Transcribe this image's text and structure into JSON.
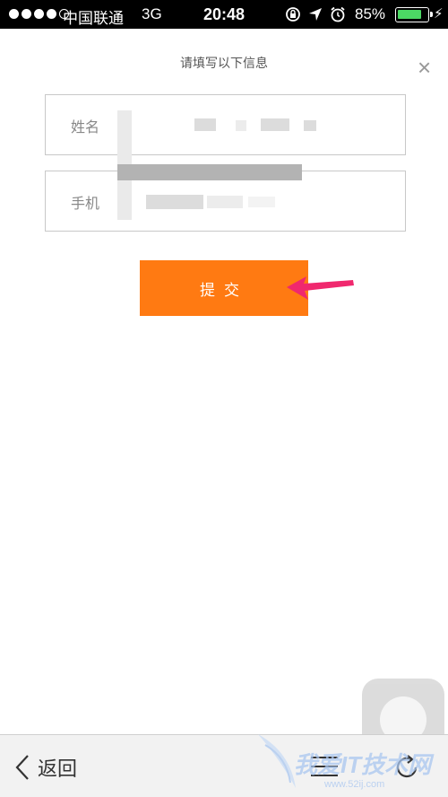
{
  "status_bar": {
    "carrier": "中国联通",
    "network": "3G",
    "time": "20:48",
    "battery": "85%",
    "battery_level": 0.85,
    "battery_color": "#4cd964"
  },
  "form": {
    "title": "请填写以下信息",
    "close_icon": "close-icon",
    "name_label": "姓名",
    "phone_label": "手机",
    "submit_label": "提交",
    "accent_color": "#ff7a12",
    "arrow_color": "#f0286e"
  },
  "bottom_bar": {
    "back_label": "返回",
    "menu_icon": "menu-icon",
    "refresh_icon": "refresh-icon"
  },
  "watermark": {
    "text": "我爱IT技术网",
    "url": "www.52ij.com"
  }
}
